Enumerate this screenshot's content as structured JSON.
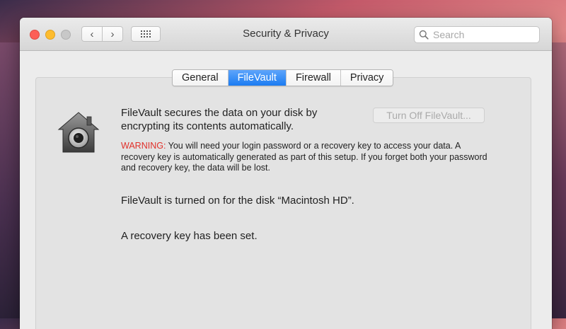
{
  "window": {
    "title": "Security & Privacy"
  },
  "toolbar": {
    "back_label": "‹",
    "forward_label": "›",
    "search_placeholder": "Search"
  },
  "tabs": [
    {
      "label": "General",
      "active": false
    },
    {
      "label": "FileVault",
      "active": true
    },
    {
      "label": "Firewall",
      "active": false
    },
    {
      "label": "Privacy",
      "active": false
    }
  ],
  "filevault": {
    "description": "FileVault secures the data on your disk by encrypting its contents automatically.",
    "turn_off_button": "Turn Off FileVault...",
    "warning_label": "WARNING:",
    "warning_text": " You will need your login password or a recovery key to access your data. A recovery key is automatically generated as part of this setup. If you forget both your password and recovery key, the data will be lost.",
    "disk_status": "FileVault is turned on for the disk “Macintosh HD”.",
    "recovery_status": "A recovery key has been set."
  },
  "colors": {
    "accent": "#1b7cf2",
    "warning": "#e0302a",
    "close": "#fc5f57",
    "minimize": "#fdbc2e",
    "zoom_disabled": "#c8c8c8"
  },
  "icons": [
    "filevault-house-lock-icon",
    "search-icon",
    "chevron-left-icon",
    "chevron-right-icon",
    "grid-icon"
  ]
}
